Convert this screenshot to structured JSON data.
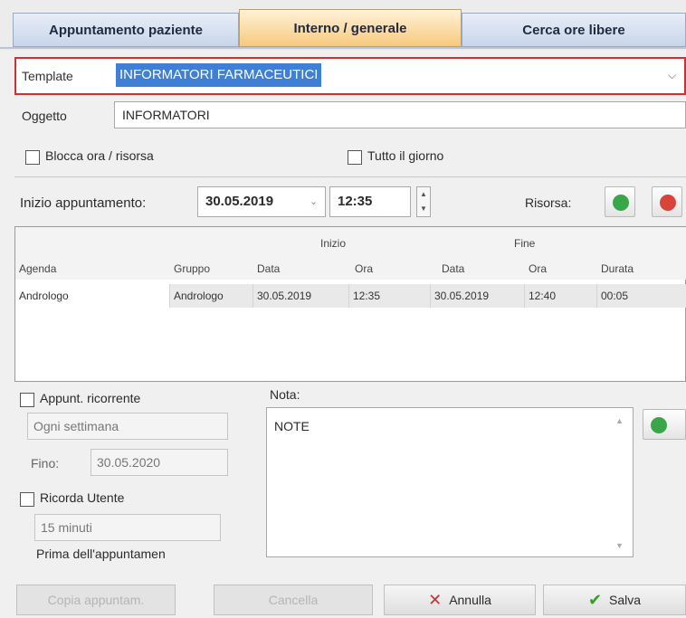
{
  "tabs": [
    {
      "label": "Appuntamento paziente",
      "active": false
    },
    {
      "label": "Interno / generale",
      "active": true
    },
    {
      "label": "Cerca ore libere",
      "active": false
    }
  ],
  "template": {
    "label": "Template",
    "value": "INFORMATORI FARMACEUTICI"
  },
  "oggetto": {
    "label": "Oggetto",
    "value": "INFORMATORI"
  },
  "options": {
    "blocca": "Blocca ora / risorsa",
    "tutto_giorno": "Tutto il giorno"
  },
  "start": {
    "label": "Inizio appuntamento:",
    "date": "30.05.2019",
    "time": "12:35",
    "risorsa_label": "Risorsa:"
  },
  "grid": {
    "group_headers": {
      "inizio": "Inizio",
      "fine": "Fine"
    },
    "columns": [
      "Agenda",
      "Gruppo",
      "Data",
      "Ora",
      "Data",
      "Ora",
      "Durata"
    ],
    "rows": [
      [
        "Andrologo",
        "Andrologo",
        "30.05.2019",
        "12:35",
        "30.05.2019",
        "12:40",
        "00:05"
      ]
    ]
  },
  "ricorrente": {
    "label": "Appunt. ricorrente",
    "frequency": "Ogni settimana",
    "fino_label": "Fino:",
    "fino_date": "30.05.2020"
  },
  "ricorda": {
    "label": "Ricorda Utente",
    "interval": "15 minuti",
    "prima": "Prima dell'appuntamen"
  },
  "nota": {
    "label": "Nota:",
    "value": "NOTE"
  },
  "buttons": {
    "copia": "Copia appuntam.",
    "cancella": "Cancella",
    "annulla": "Annulla",
    "salva": "Salva"
  },
  "colors": {
    "accent_tab": "#f7c97e",
    "highlight": "#3f7fd6",
    "error_border": "#d0302f",
    "cancel_x": "#d42b2b",
    "save_check": "#3a9a2a"
  },
  "icons": {
    "add_resource": "add-green-icon",
    "remove_resource": "remove-red-icon",
    "add_note": "add-green-icon"
  }
}
